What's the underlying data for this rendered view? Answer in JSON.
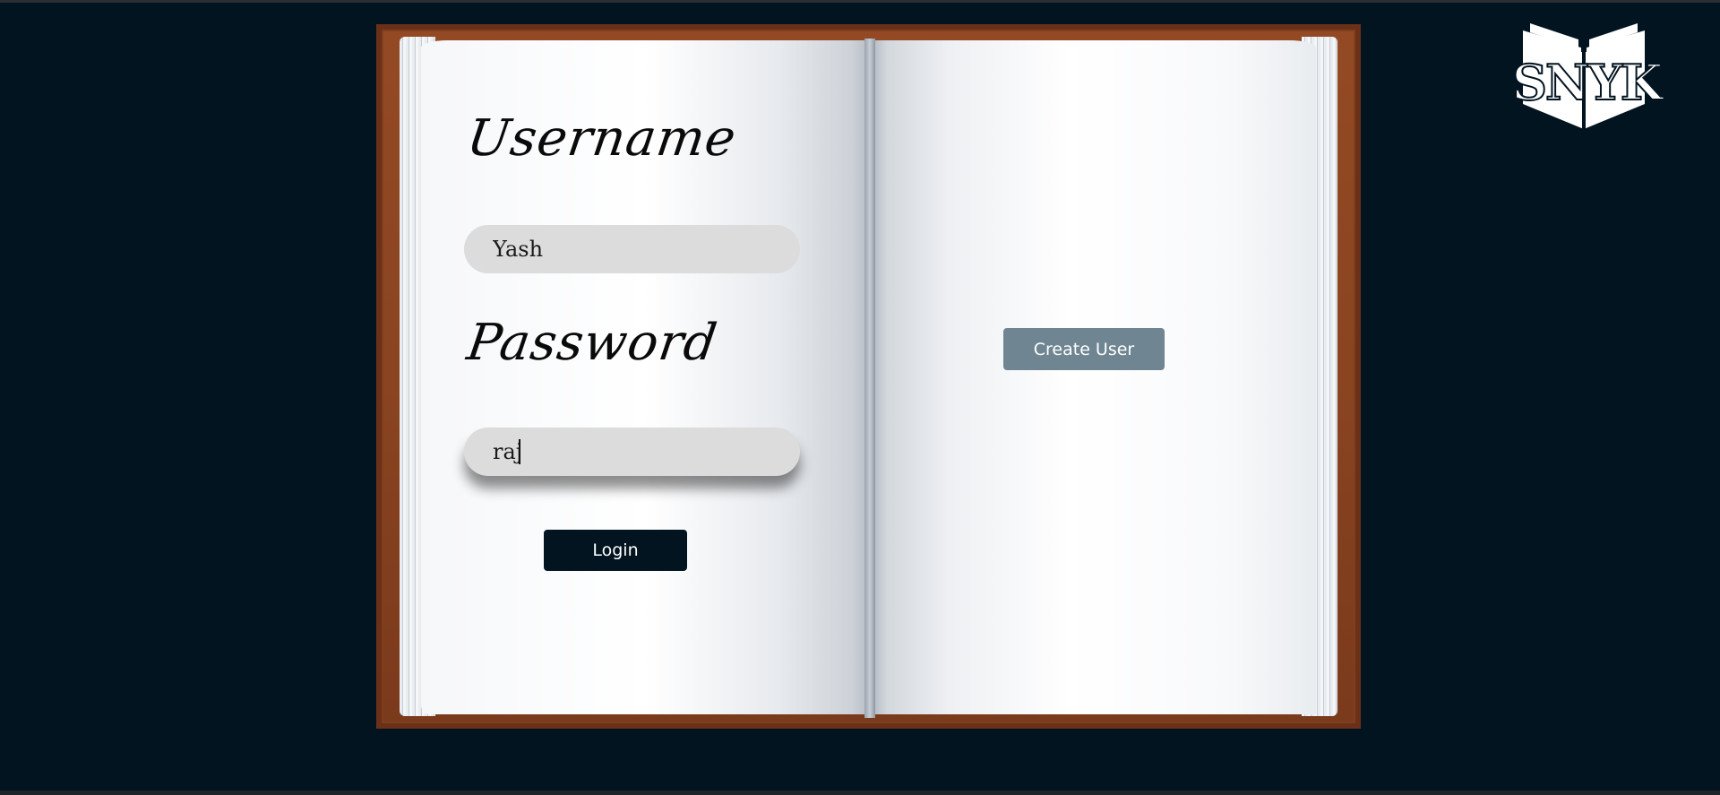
{
  "login_form": {
    "username_label": "Username",
    "username_value": "Yash",
    "password_label": "Password",
    "password_value": "raj",
    "login_button": "Login"
  },
  "right_page": {
    "create_user_button": "Create User"
  },
  "logo": {
    "text": "SNYK",
    "icon": "open-book-icon"
  },
  "colors": {
    "background": "#021420",
    "book_cover": "#7f3f1f",
    "login_button": "#021420",
    "create_user_button": "#6f8592",
    "input_fill": "#dcdcdc"
  }
}
